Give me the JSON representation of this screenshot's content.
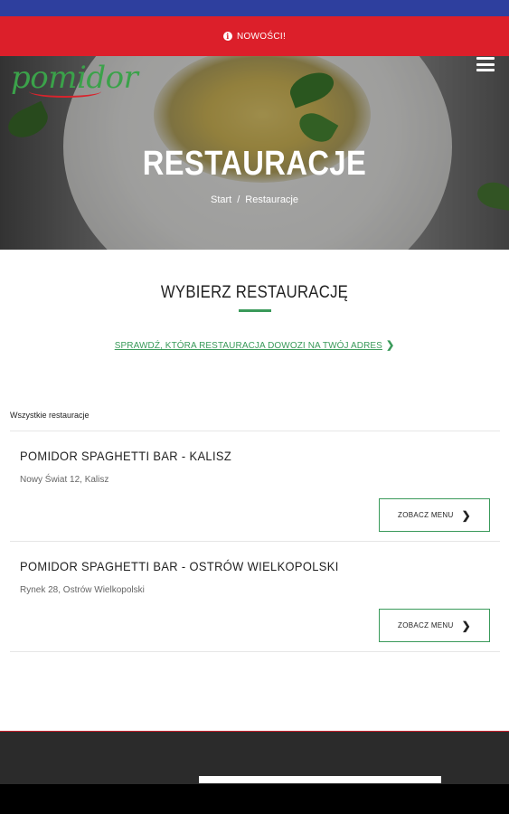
{
  "news_bar": {
    "label": "NOWOŚCI!",
    "icon": "info-icon"
  },
  "brand": {
    "logo_text": "pomidor",
    "accent": "#3ba24a",
    "news_color": "#dc1f2a"
  },
  "hero": {
    "title": "RESTAURACJE",
    "breadcrumb": {
      "home": "Start",
      "separator": "/",
      "current": "Restauracje"
    }
  },
  "section": {
    "title": "WYBIERZ RESTAURACJĘ",
    "check_link": "SPRAWDŹ, KTÓRA RESTAURACJA DOWOZI NA TWÓJ ADRES"
  },
  "list": {
    "label": "Wszystkie restauracje",
    "items": [
      {
        "name": "POMIDOR SPAGHETTI BAR - KALISZ",
        "address": "Nowy Świat 12, Kalisz",
        "button": "ZOBACZ MENU"
      },
      {
        "name": "POMIDOR SPAGHETTI BAR - OSTRÓW WIELKOPOLSKI",
        "address": "Rynek 28, Ostrów Wielkopolski",
        "button": "ZOBACZ MENU"
      }
    ]
  }
}
